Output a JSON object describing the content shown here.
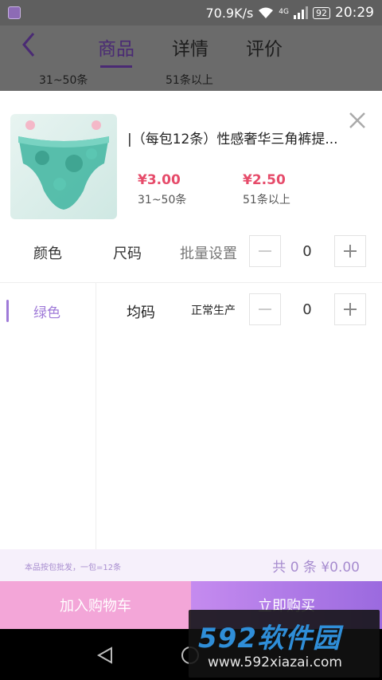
{
  "status_bar": {
    "net_speed": "70.9K/s",
    "network": "4G",
    "battery": "92",
    "time": "20:29"
  },
  "nav": {
    "tabs": [
      {
        "label": "商品",
        "active": true
      },
      {
        "label": "详情",
        "active": false
      },
      {
        "label": "评价",
        "active": false
      }
    ],
    "range_left": "31~50条",
    "range_right": "51条以上"
  },
  "product": {
    "title": "|（每包12条）性感奢华三角裤提...",
    "prices": [
      {
        "price": "¥3.00",
        "range": "31~50条"
      },
      {
        "price": "¥2.50",
        "range": "51条以上"
      }
    ]
  },
  "selector": {
    "color_header": "颜色",
    "size_header": "尺码",
    "batch_label": "批量设置",
    "batch_qty": "0",
    "colors": [
      "绿色"
    ],
    "rows": [
      {
        "size": "均码",
        "status": "正常生产",
        "qty": "0"
      }
    ]
  },
  "summary": {
    "note": "本品按包批发，一包=12条",
    "total": "共 0 条  ¥0.00"
  },
  "actions": {
    "add_to_cart": "加入购物车",
    "buy_now": "立即购买"
  },
  "watermark": {
    "brand": "592软件园",
    "url": "www.592xiazai.com"
  },
  "colors": {
    "accent": "#9f7ad8",
    "price_red": "#e64b6a",
    "cart_pink": "#f3a6d8",
    "buy_purple": "#b37de8"
  }
}
